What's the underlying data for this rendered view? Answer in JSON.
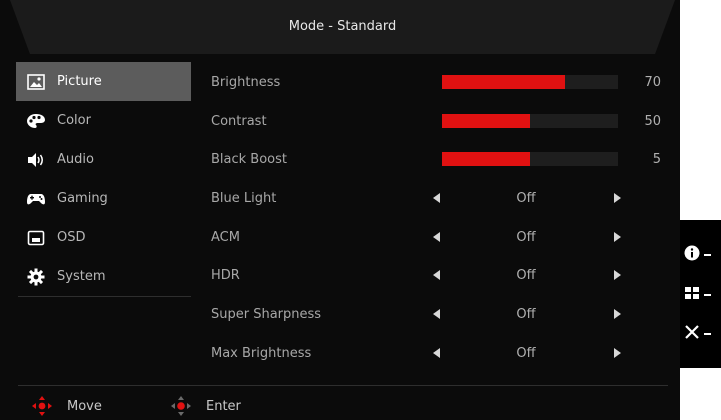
{
  "header": {
    "title": "Mode - Standard"
  },
  "sidebar": {
    "items": [
      {
        "label": "Picture",
        "icon": "picture-icon",
        "active": true
      },
      {
        "label": "Color",
        "icon": "palette-icon",
        "active": false
      },
      {
        "label": "Audio",
        "icon": "speaker-icon",
        "active": false
      },
      {
        "label": "Gaming",
        "icon": "gamepad-icon",
        "active": false
      },
      {
        "label": "OSD",
        "icon": "osd-icon",
        "active": false
      },
      {
        "label": "System",
        "icon": "gear-icon",
        "active": false
      }
    ]
  },
  "settings": {
    "brightness": {
      "label": "Brightness",
      "value": "70",
      "level_percent": 70
    },
    "contrast": {
      "label": "Contrast",
      "value": "50",
      "level_percent": 50
    },
    "black_boost": {
      "label": "Black Boost",
      "value": "5",
      "level_percent": 50
    },
    "blue_light": {
      "label": "Blue Light",
      "value": "Off"
    },
    "acm": {
      "label": "ACM",
      "value": "Off"
    },
    "hdr": {
      "label": "HDR",
      "value": "Off"
    },
    "super_sharpness": {
      "label": "Super Sharpness",
      "value": "Off"
    },
    "max_brightness": {
      "label": "Max Brightness",
      "value": "Off"
    }
  },
  "footer": {
    "move_label": "Move",
    "enter_label": "Enter"
  },
  "hotkeys": [
    "info-icon",
    "grid-icon",
    "close-icon"
  ],
  "colors": {
    "accent": "#e01111",
    "active_item": "#5c5c5c",
    "background": "#0b0b0b"
  }
}
